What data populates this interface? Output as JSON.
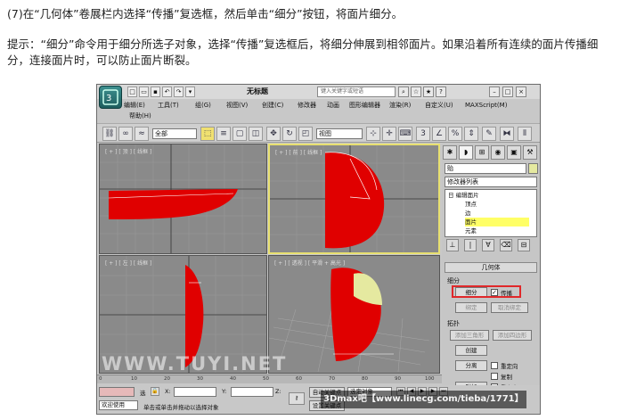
{
  "instructions": {
    "step": "(7)在“几何体”卷展栏内选择“传播”复选框，然后单击“细分”按钮，将面片细分。",
    "tip": "提示：“细分”命令用于细分所选子对象，选择“传播”复选框后，将细分伸展到相邻面片。如果沿着所有连续的面片传播细分，连接面片时，可以防止面片断裂。"
  },
  "window": {
    "title": "无标题",
    "search_placeholder": "键入关键字或短语"
  },
  "menus": [
    "编辑(E)",
    "工具(T)",
    "组(G)",
    "视图(V)",
    "创建(C)",
    "修改器",
    "动画",
    "图形编辑器",
    "渲染(R)",
    "自定义(U)",
    "MAXScript(M)"
  ],
  "menu_help": "帮助(H)",
  "toolbar": {
    "selection_filter": "全部",
    "ref_coord": "视图",
    "snap_label": "3"
  },
  "viewports": {
    "top": "[ + ] [ 顶 ] [ 线框 ]",
    "front": "[ + ] [ 前 ] [ 线框 ]",
    "left": "[ + ] [ 左 ] [ 线框 ]",
    "perspective": "[ + ] [ 透视 ] [ 平滑 + 高光 ]"
  },
  "command_panel": {
    "object_name": "贻",
    "modifier_list": "修改器列表",
    "stack": [
      {
        "label": "日  编辑面片",
        "selected": false
      },
      {
        "label": "顶点",
        "selected": false
      },
      {
        "label": "边",
        "selected": false
      },
      {
        "label": "面片",
        "selected": true
      },
      {
        "label": "元素",
        "selected": false
      }
    ],
    "rollout_title": "几何体",
    "subdivide_group": "细分",
    "subdivide_button": "细分",
    "propagate_label": "传播",
    "propagate_checked": true,
    "bind_button": "绑定",
    "unbind_button": "取消绑定",
    "topology_group": "拓扑",
    "add_tri_button": "添加三角形",
    "add_quad_button": "添加四边形",
    "create_button": "创建",
    "detach_button": "分离",
    "reorient_label": "重定向",
    "copy_label": "复制",
    "attach_button": "附加",
    "reorient2_label": "重定向"
  },
  "timeline": {
    "ticks": [
      "0",
      "10",
      "20",
      "30",
      "40",
      "50",
      "60",
      "70",
      "80",
      "90",
      "100"
    ]
  },
  "status": {
    "selected": "选",
    "welcome": "欢迎使用",
    "prompt": "单击或单击并拖动以选择对象",
    "x_label": "X:",
    "y_label": "Y:",
    "z_label": "Z:",
    "auto_key": "自动关键点",
    "set_key": "设置关键点",
    "selected_object": "选定对象"
  },
  "watermarks": {
    "site": "WWW.TUYI.NET",
    "forum": "3Dmax吧【www.linecg.com/tieba/1771】"
  },
  "colors": {
    "shell_red": "#e00000",
    "patch_highlight": "#e5e9a0",
    "callout_red": "#e0282a",
    "viewport_bg": "#8a8a8a",
    "active_border": "#e8e070"
  }
}
